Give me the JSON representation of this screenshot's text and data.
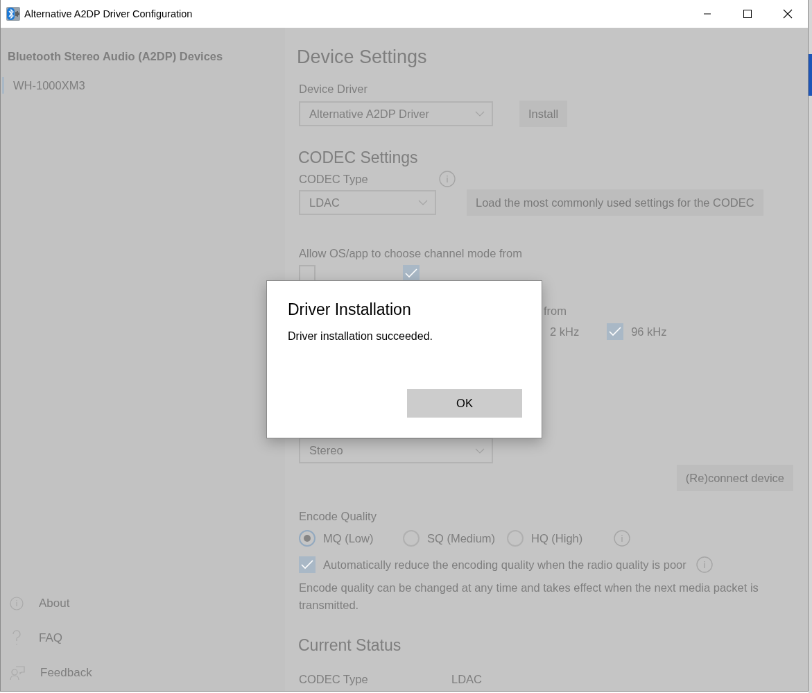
{
  "window": {
    "title": "Alternative A2DP Driver Configuration"
  },
  "sidebar": {
    "title": "Bluetooth Stereo Audio (A2DP) Devices",
    "devices": [
      {
        "label": "WH-1000XM3",
        "selected": true
      }
    ],
    "footer_items": [
      {
        "kind": "info",
        "label": "About"
      },
      {
        "kind": "help",
        "label": "FAQ"
      },
      {
        "kind": "feedback",
        "label": "Feedback"
      }
    ]
  },
  "main": {
    "heading": "Device Settings",
    "device_driver": {
      "label": "Device Driver",
      "value": "Alternative A2DP Driver"
    },
    "install_button": "Install",
    "codec_heading": "CODEC Settings",
    "codec_type": {
      "label": "CODEC Type",
      "value": "LDAC"
    },
    "load_button": "Load the most commonly used settings for the CODEC",
    "channel_mode": {
      "label": "Allow OS/app to choose channel mode from",
      "options": [
        {
          "checked": false
        },
        {
          "checked": true
        }
      ]
    },
    "sample_rate": {
      "label_fragment": "from",
      "options": [
        {
          "label": "2 kHz"
        },
        {
          "label": "96 kHz",
          "checked": true
        }
      ]
    },
    "stereo_mode": {
      "value": "Stereo"
    },
    "reconnect_button": "(Re)connect device",
    "encode_quality": {
      "label": "Encode Quality",
      "options": [
        {
          "label": "MQ (Low)",
          "selected": true
        },
        {
          "label": "SQ (Medium)",
          "selected": false
        },
        {
          "label": "HQ (High)",
          "selected": false
        }
      ],
      "auto_reduce": {
        "label": "Automatically reduce the encoding quality when the radio quality is poor",
        "checked": true
      },
      "note": "Encode quality can be changed at any time and takes effect when the next media packet is transmitted."
    },
    "current_status": {
      "heading": "Current Status",
      "rows": [
        {
          "label": "CODEC Type",
          "value": "LDAC"
        }
      ]
    }
  },
  "dialog": {
    "title": "Driver Installation",
    "message": "Driver installation succeeded.",
    "button": "OK"
  }
}
